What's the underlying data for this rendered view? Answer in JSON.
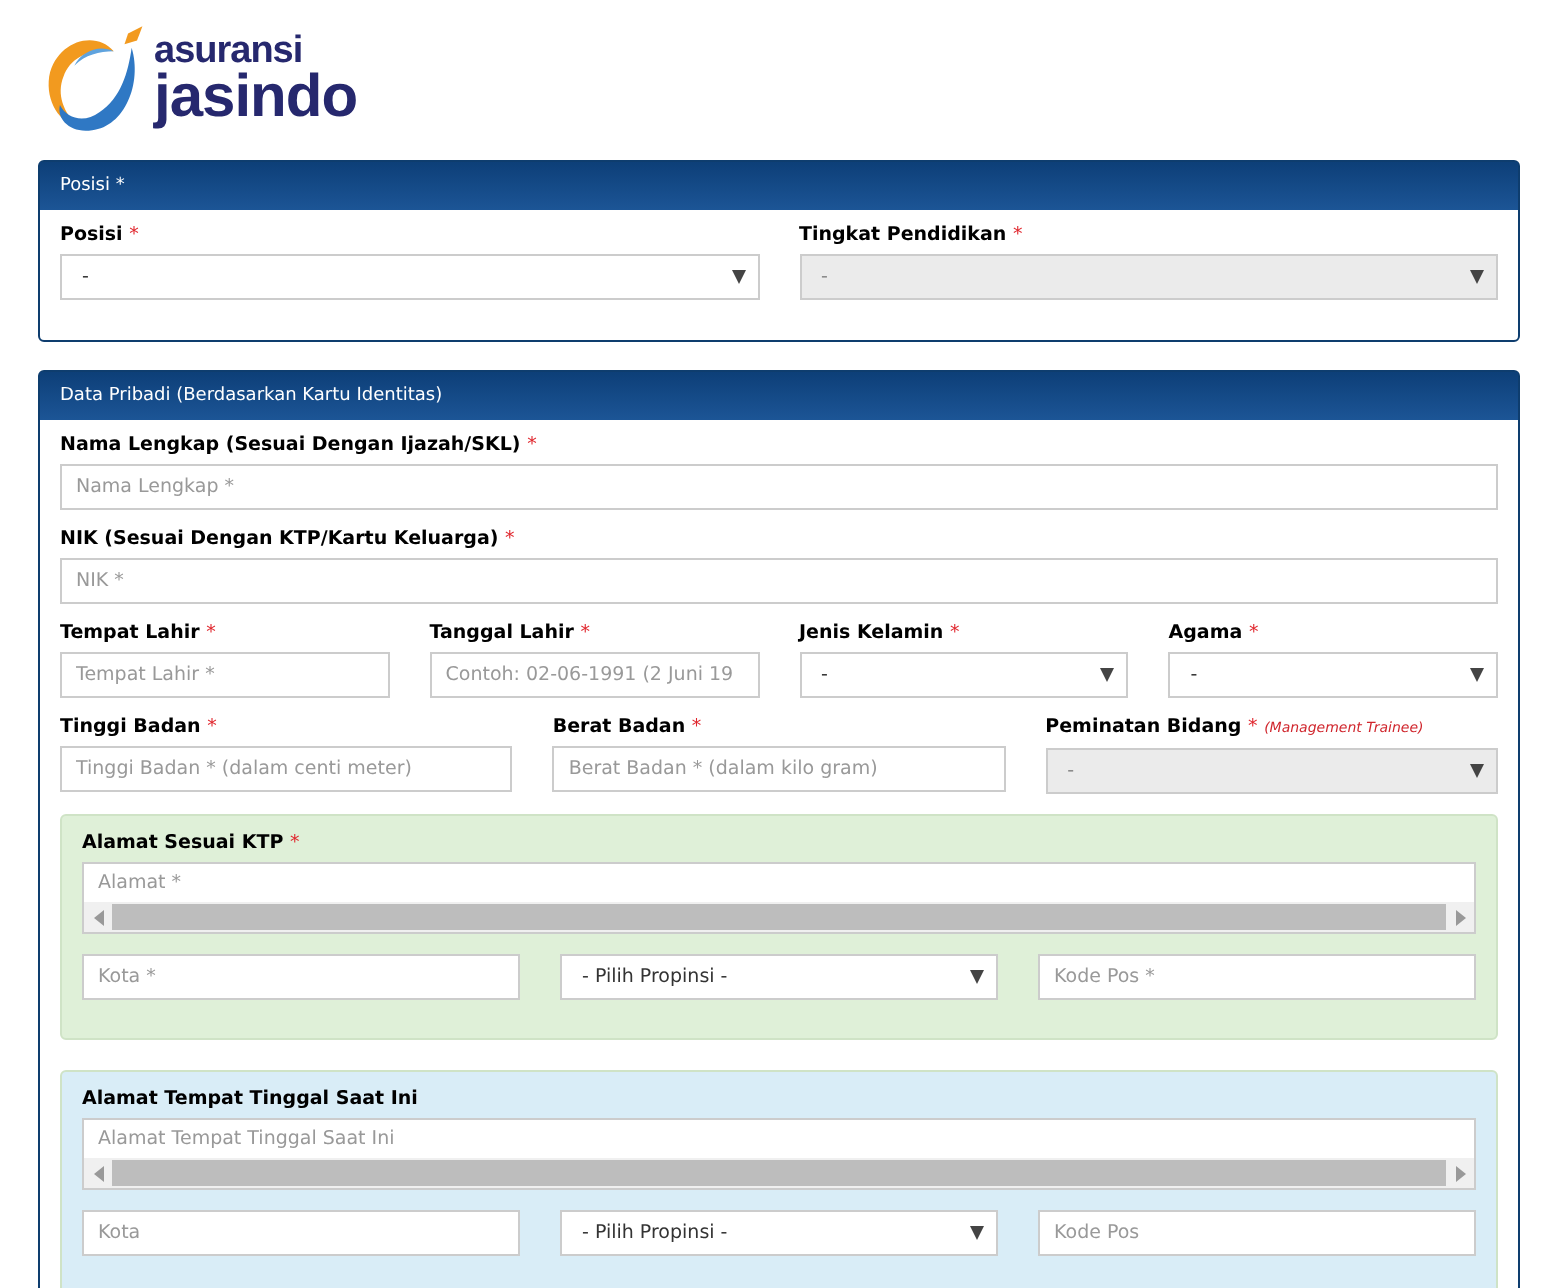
{
  "logo": {
    "line_1": "asuransi",
    "line_2": "jasindo"
  },
  "panels": [
    {
      "title": "Posisi *",
      "rows": [
        {
          "fields": [
            {
              "kind": "select",
              "label": "Posisi",
              "required_mark": "*",
              "value": "-",
              "disabled": false
            },
            {
              "kind": "select",
              "label": "Tingkat Pendidikan",
              "required_mark": "*",
              "value": "-",
              "disabled": true
            }
          ]
        }
      ]
    },
    {
      "title": "Data Pribadi (Berdasarkan Kartu Identitas)",
      "rows": [
        {
          "fields": [
            {
              "kind": "input",
              "label": "Nama Lengkap (Sesuai Dengan Ijazah/SKL)",
              "required_mark": "*",
              "placeholder": "Nama Lengkap *"
            }
          ]
        },
        {
          "fields": [
            {
              "kind": "input",
              "label": "NIK (Sesuai Dengan KTP/Kartu Keluarga)",
              "required_mark": "*",
              "placeholder": "NIK *"
            }
          ]
        },
        {
          "fields": [
            {
              "kind": "input",
              "label": "Tempat Lahir",
              "required_mark": "*",
              "placeholder": "Tempat Lahir *"
            },
            {
              "kind": "input",
              "label": "Tanggal Lahir",
              "required_mark": "*",
              "placeholder": "Contoh: 02-06-1991 (2 Juni 19"
            },
            {
              "kind": "select",
              "label": "Jenis Kelamin",
              "required_mark": "*",
              "value": "-",
              "disabled": false
            },
            {
              "kind": "select",
              "label": "Agama",
              "required_mark": "*",
              "value": "-",
              "disabled": false
            }
          ]
        },
        {
          "fields": [
            {
              "kind": "input",
              "label": "Tinggi Badan",
              "required_mark": "*",
              "placeholder": "Tinggi Badan * (dalam centi meter)"
            },
            {
              "kind": "input",
              "label": "Berat Badan",
              "required_mark": "*",
              "placeholder": "Berat Badan * (dalam kilo gram)"
            },
            {
              "kind": "select",
              "label": "Peminatan Bidang",
              "required_mark": "*",
              "note": "(Management Trainee)",
              "value": "-",
              "disabled": true
            }
          ]
        }
      ],
      "addresses": [
        {
          "label": "Alamat Sesuai KTP",
          "required_mark": "*",
          "color": "#dff0d8",
          "address_placeholder": "Alamat *",
          "city_placeholder": "Kota *",
          "province": "- Pilih Propinsi -",
          "postcode_placeholder": "Kode Pos *"
        },
        {
          "label": "Alamat Tempat Tinggal Saat Ini",
          "color": "#d9edf7",
          "address_placeholder": "Alamat Tempat Tinggal Saat Ini",
          "city_placeholder": "Kota",
          "province": "- Pilih Propinsi -",
          "postcode_placeholder": "Kode Pos"
        }
      ]
    }
  ]
}
